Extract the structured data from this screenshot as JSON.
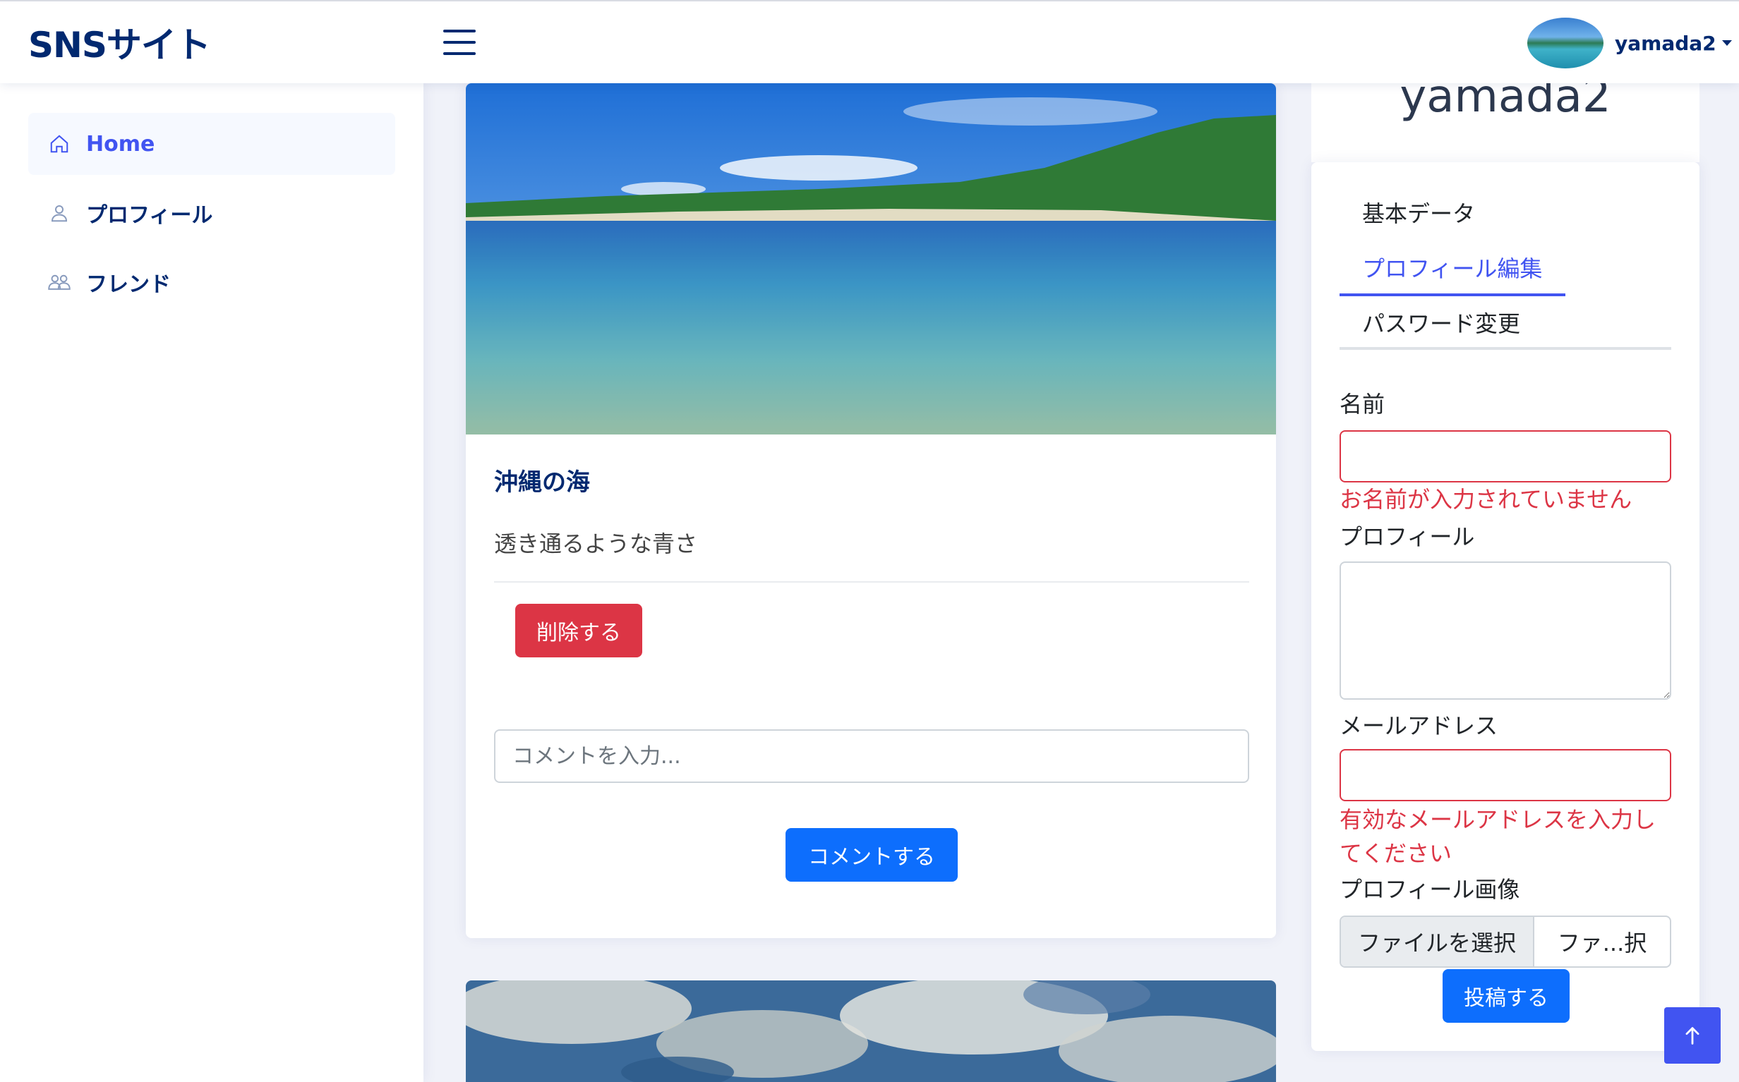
{
  "header": {
    "brand": "SNSサイト",
    "username": "yamada2"
  },
  "sidebar": {
    "items": [
      {
        "label": "Home",
        "icon": "home-icon",
        "active": true
      },
      {
        "label": "プロフィール",
        "icon": "person-icon"
      },
      {
        "label": "フレンド",
        "icon": "people-icon"
      }
    ]
  },
  "post": {
    "title": "沖縄の海",
    "body": "透き通るような青さ",
    "delete_label": "削除する",
    "comment_placeholder": "コメントを入力...",
    "comment_button": "コメントする"
  },
  "profile": {
    "name": "yamada2",
    "tabs": [
      {
        "label": "基本データ"
      },
      {
        "label": "プロフィール編集",
        "active": true
      },
      {
        "label": "パスワード変更"
      }
    ],
    "form": {
      "name_label": "名前",
      "name_error": "お名前が入力されていません",
      "profile_label": "プロフィール",
      "email_label": "メールアドレス",
      "email_error": "有効なメールアドレスを入力してください",
      "image_label": "プロフィール画像",
      "file_button": "ファイルを選択",
      "file_name": "ファ...択",
      "submit_label": "投稿する"
    }
  },
  "colors": {
    "brand": "#012970",
    "accent": "#4154f1",
    "danger": "#dc3545",
    "primary": "#0d6efd"
  }
}
